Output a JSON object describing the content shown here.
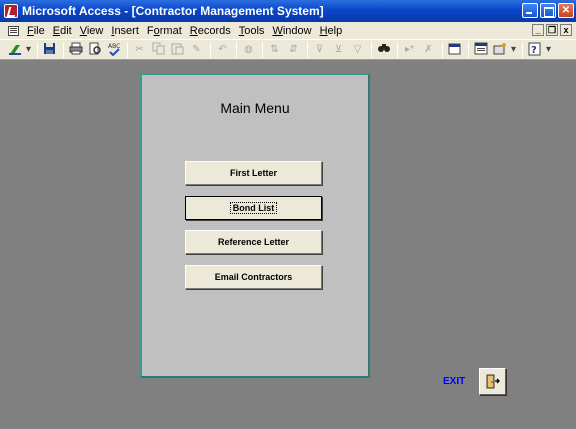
{
  "window": {
    "title": "Microsoft Access - [Contractor Management System]"
  },
  "menubar": {
    "items": [
      {
        "label": "File",
        "accel": "F",
        "rest": "ile"
      },
      {
        "label": "Edit",
        "accel": "E",
        "rest": "dit"
      },
      {
        "label": "View",
        "accel": "V",
        "rest": "iew"
      },
      {
        "label": "Insert",
        "accel": "I",
        "rest": "nsert"
      },
      {
        "label": "Format",
        "accel": "o",
        "prefix": "F",
        "rest": "rmat"
      },
      {
        "label": "Records",
        "accel": "R",
        "rest": "ecords"
      },
      {
        "label": "Tools",
        "accel": "T",
        "rest": "ools"
      },
      {
        "label": "Window",
        "accel": "W",
        "rest": "indow"
      },
      {
        "label": "Help",
        "accel": "H",
        "rest": "elp"
      }
    ]
  },
  "form": {
    "title": "Main Menu",
    "buttons": [
      {
        "label": "First Letter"
      },
      {
        "label": "Bond List"
      },
      {
        "label": "Reference Letter"
      },
      {
        "label": "Email Contractors"
      }
    ]
  },
  "exit": {
    "label": "EXIT"
  },
  "colors": {
    "background": "#808080",
    "panel": "#c0c0c0",
    "panel_border": "#2e7b74",
    "exit_text": "#0000ff",
    "titlebar": "#0a46c8"
  }
}
